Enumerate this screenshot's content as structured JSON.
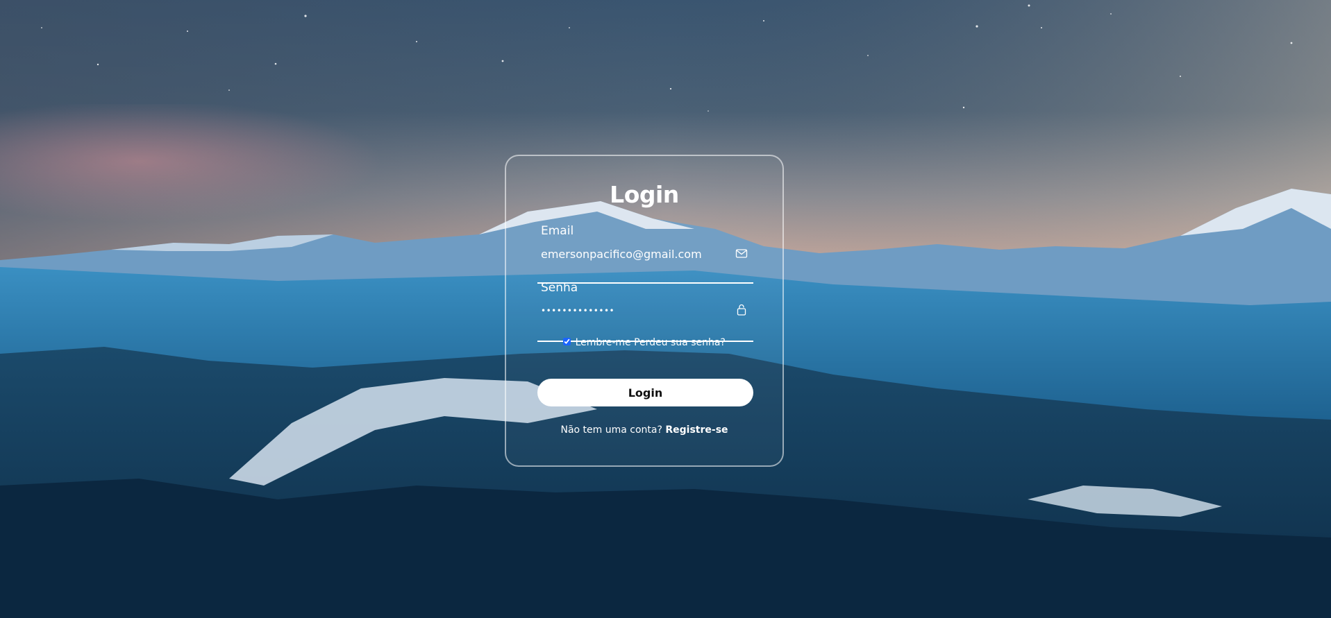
{
  "login_form": {
    "title": "Login",
    "email": {
      "label": "Email",
      "value": "emersonpacifico@gmail.com",
      "icon": "mail-icon"
    },
    "password": {
      "label": "Senha",
      "value": "••••••••••••••",
      "icon": "lock-icon"
    },
    "remember_label": "Lembre-me",
    "remember_checked": true,
    "forgot_label": "Perdeu sua senha?",
    "submit_label": "Login",
    "register_prompt": "Não tem uma conta?",
    "register_link": "Registre-se"
  },
  "colors": {
    "text": "#ffffff",
    "button_bg": "#ffffff",
    "button_text": "#111111",
    "checkbox_accent": "#1a64ff"
  }
}
